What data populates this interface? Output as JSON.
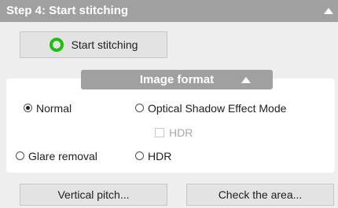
{
  "header": {
    "title": "Step 4: Start stitching",
    "collapse_icon": "triangle-up-icon"
  },
  "start_button": {
    "label": "Start stitching",
    "status_icon": "green-ring-icon",
    "status_color": "#1cc10f"
  },
  "image_format": {
    "tab_label": "Image format",
    "options": {
      "normal": {
        "label": "Normal",
        "checked": true
      },
      "optical_shadow": {
        "label": "Optical Shadow Effect Mode",
        "checked": false
      },
      "hdr_sub": {
        "label": "HDR",
        "checked": false,
        "enabled": false
      },
      "glare_removal": {
        "label": "Glare removal",
        "checked": false
      },
      "hdr": {
        "label": "HDR",
        "checked": false
      }
    }
  },
  "bottom_buttons": {
    "vertical_pitch": "Vertical pitch...",
    "check_area": "Check the area..."
  },
  "colors": {
    "header_bg": "#a0a0a0",
    "panel_bg": "#eeeeee",
    "button_bg": "#e3e3e3"
  }
}
